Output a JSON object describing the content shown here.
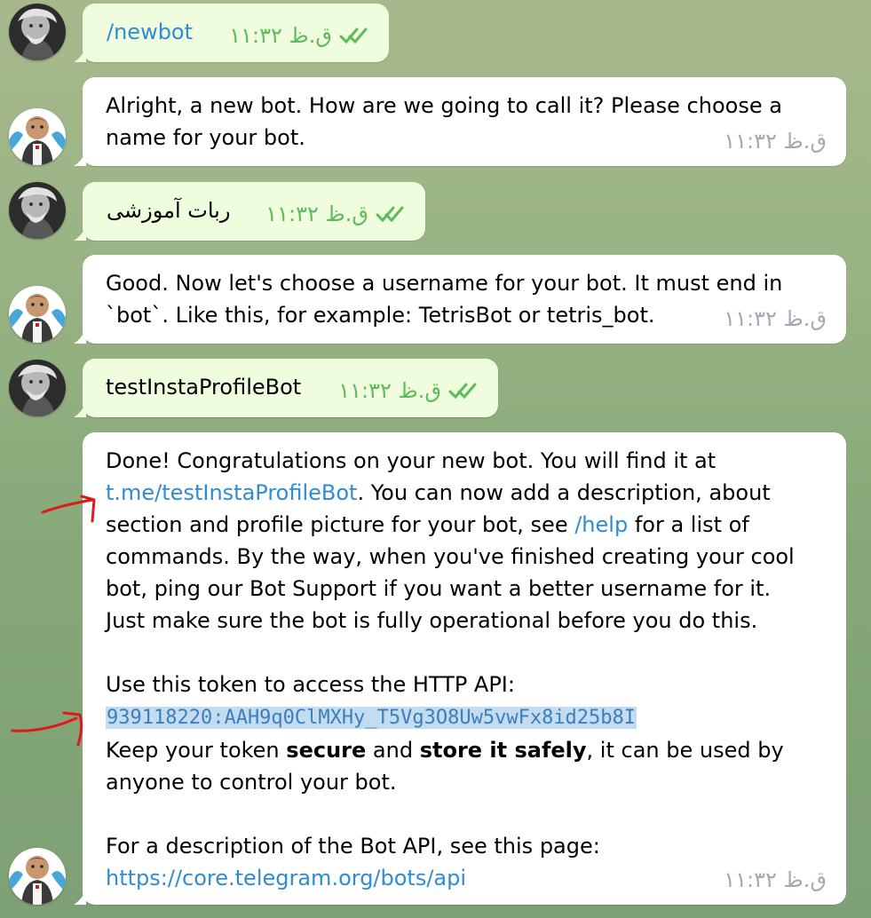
{
  "messages": [
    {
      "text": "/newbot",
      "time": "ق.ظ ۱۱:۳۲"
    },
    {
      "text": "Alright, a new bot. How are we going to call it? Please choose a name for your bot.",
      "time": "ق.ظ ۱۱:۳۲"
    },
    {
      "text": "ربات آموزشی",
      "time": "ق.ظ ۱۱:۳۲"
    },
    {
      "text": "Good. Now let's choose a username for your bot. It must end in `bot`. Like this, for example: TetrisBot or tetris_bot.",
      "time": "ق.ظ ۱۱:۳۲"
    },
    {
      "text": "testInstaProfileBot",
      "time": "ق.ظ ۱۱:۳۲"
    },
    {
      "time": "ق.ظ ۱۱:۳۲",
      "p1_a": "Done! Congratulations on your new bot. You will find it at ",
      "link_tme": "t.me/testInstaProfileBot",
      "p1_b": ". You can now add a description, about section and profile picture for your bot, see ",
      "link_help": "/help",
      "p1_c": " for a list of commands. By the way, when you've finished creating your cool bot, ping our Bot Support if you want a better username for it. Just make sure the bot is fully operational before you do this.",
      "p2_intro": "Use this token to access the HTTP API:",
      "token": "939118220:AAH9q0ClMXHy_T5Vg3O8Uw5vwFx8id25b8I",
      "p2_a": "Keep your token ",
      "p2_secure": "secure",
      "p2_and": " and ",
      "p2_store": "store it safely",
      "p2_b": ", it can be used by anyone to control your bot.",
      "p3": "For a description of the Bot API, see this page:",
      "link_api": "https://core.telegram.org/bots/api"
    }
  ],
  "colors": {
    "outgoing_bubble": "#effdde",
    "incoming_bubble": "#ffffff",
    "link": "#2f8cd3",
    "check": "#5dbc5a",
    "time_in": "#a1aab3",
    "annotation": "#e0191c"
  },
  "icons": {
    "user_avatar": "user-avatar",
    "bot_avatar": "botfather-avatar",
    "read_receipt": "double-check-icon",
    "annotation_arrow": "red-arrow"
  }
}
